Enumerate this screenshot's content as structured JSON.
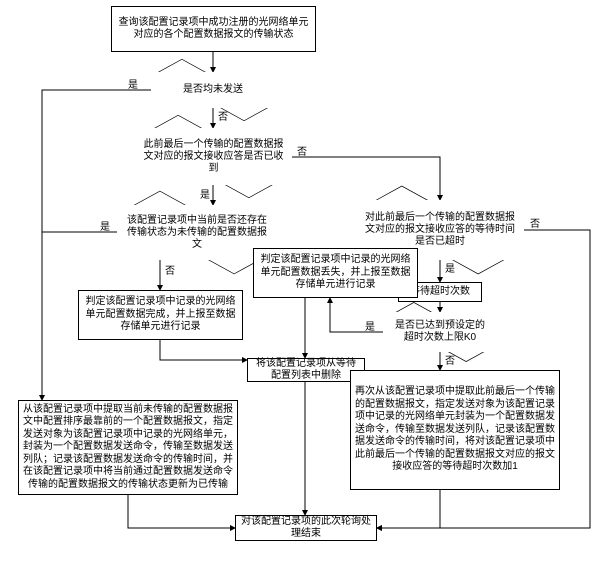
{
  "flow": {
    "start": "查询该配置记录项中成功注册的光网络单元对应的各个配置数据报文的传输状态",
    "d1": "是否均未发送",
    "d2": "此前最后一个传输的配置数据报文对应的报文接收应答是否已收到",
    "d3": "该配置记录项中当前是否还存在传输状态为未传输的配置数据报文",
    "d4": "对此前最后一个传输的配置数据报文对应的报文接收应答的等待时间是否已超时",
    "d5": "是否已达到预设定的超时次数上限K0",
    "p_complete": "判定该配置记录项中记录的光网络单元配置数据完成，并上报至数据存储单元进行记录",
    "p_lost": "判定该配置记录项中记录的光网络单元配置数据丢失，并上报至数据存储单元进行记录",
    "p_remove": "将该配置记录项从等待配置列表中删除",
    "p_left": "从该配置记录项中提取当前未传输的配置数据报文中配置排序最靠前的一个配置数据报文，指定发送对象为该配置记录项中记录的光网络单元，封装为一个配置数据发送命令，传输至数据发送列队；记录该配置数据发送命令的传输时间，并在该配置记录项中将当前通过配置数据发送命令传输的配置数据报文的传输状态更新为已传输",
    "p_right": "再次从该配置记录项中提取此前最后一个传输的配置数据报文，指定发送对象为该配置记录项中记录的光网络单元封装为一个配置数据发送命令，传输至数据发送列队，记录该配置数据发送命令的传输时间，将对该配置记录项中此前最后一个传输的配置数据报文对应的报文接收应答的等待超时次数加1",
    "p_wait": "等待超时次数",
    "end": "对该配置记录项的此次轮询处理结束"
  },
  "labels": {
    "yes": "是",
    "no": "否"
  }
}
